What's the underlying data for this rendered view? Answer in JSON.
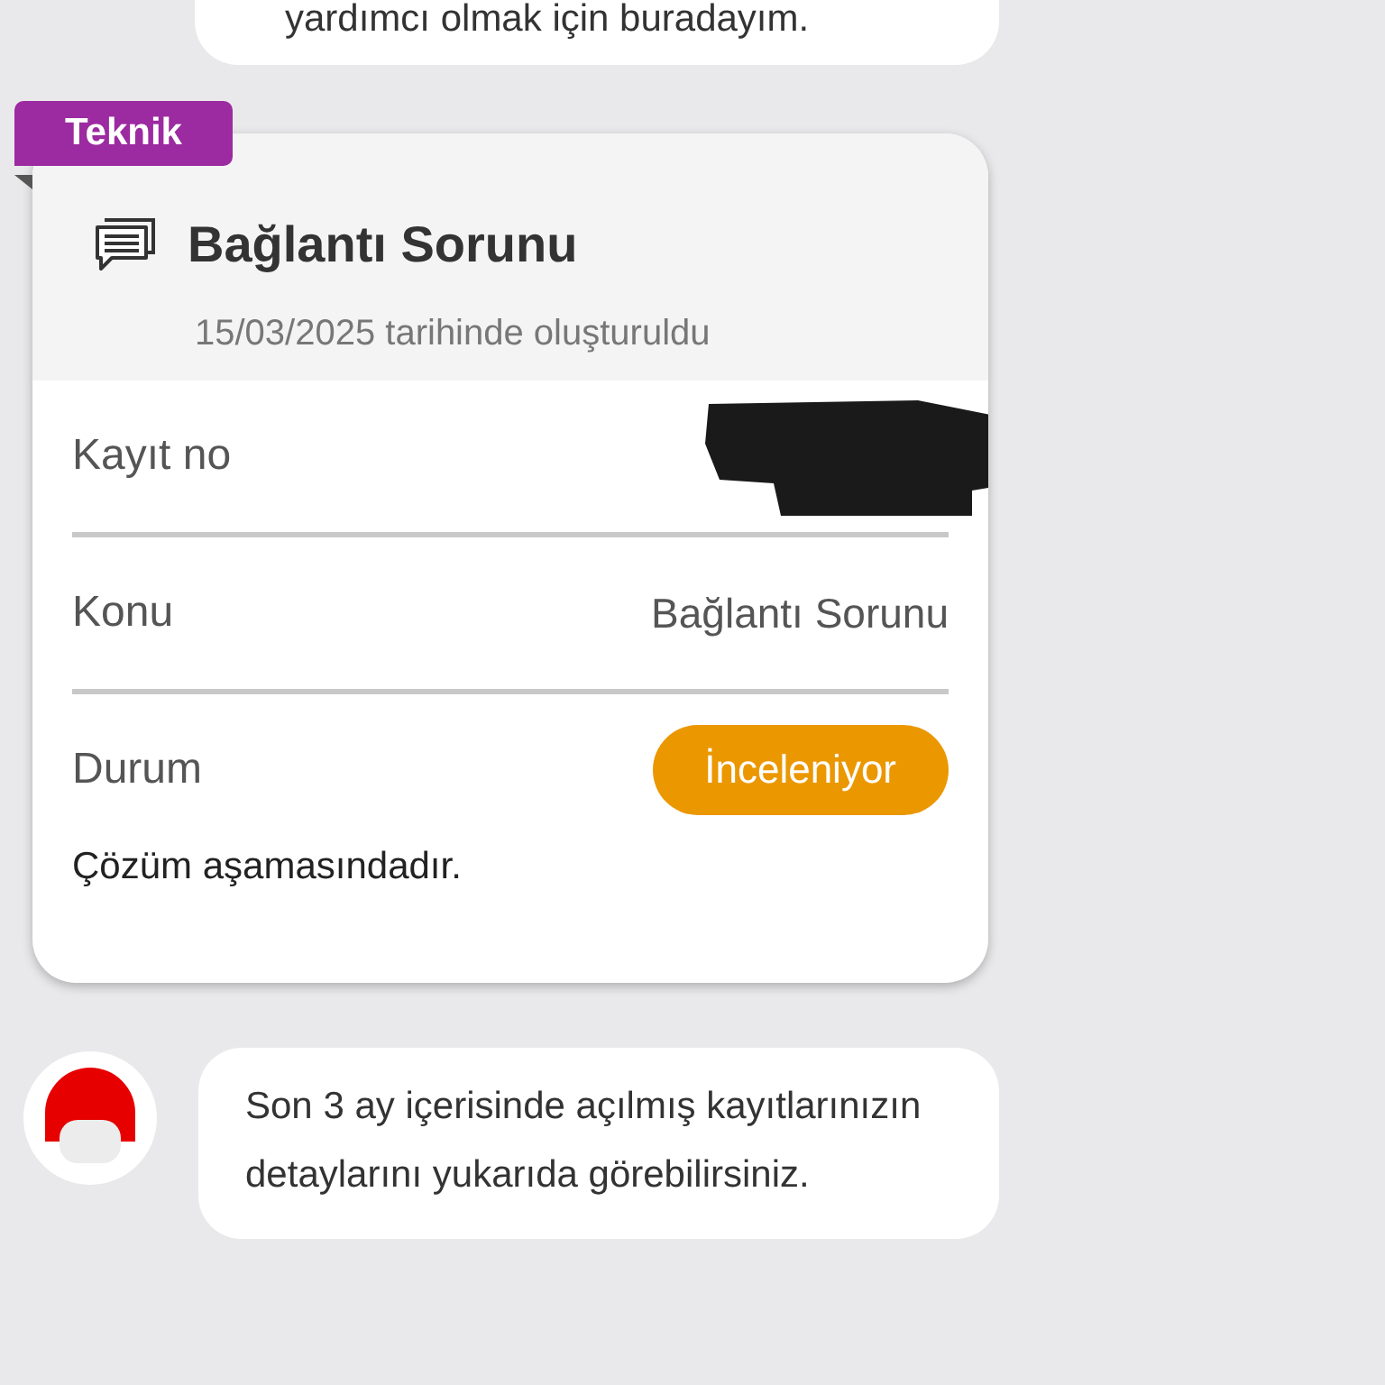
{
  "messages_before": [
    {
      "text": "yardımcı olmak için buradayım."
    }
  ],
  "ticket": {
    "category": "Teknik",
    "title": "Bağlantı Sorunu",
    "created": "15/03/2025 tarihinde oluşturuldu",
    "rows": [
      {
        "label": "Kayıt no",
        "kind": "redacted"
      },
      {
        "label": "Konu",
        "kind": "text",
        "value": "Bağlantı Sorunu"
      },
      {
        "label": "Durum",
        "kind": "status",
        "value": "İnceleniyor",
        "color": "#eb9700"
      }
    ],
    "note": "Çözüm aşamasındadır."
  },
  "messages_after": [
    {
      "text": "Son 3 ay içerisinde açılmış kayıtlarınızın detaylarını yukarıda görebilirsiniz."
    }
  ]
}
